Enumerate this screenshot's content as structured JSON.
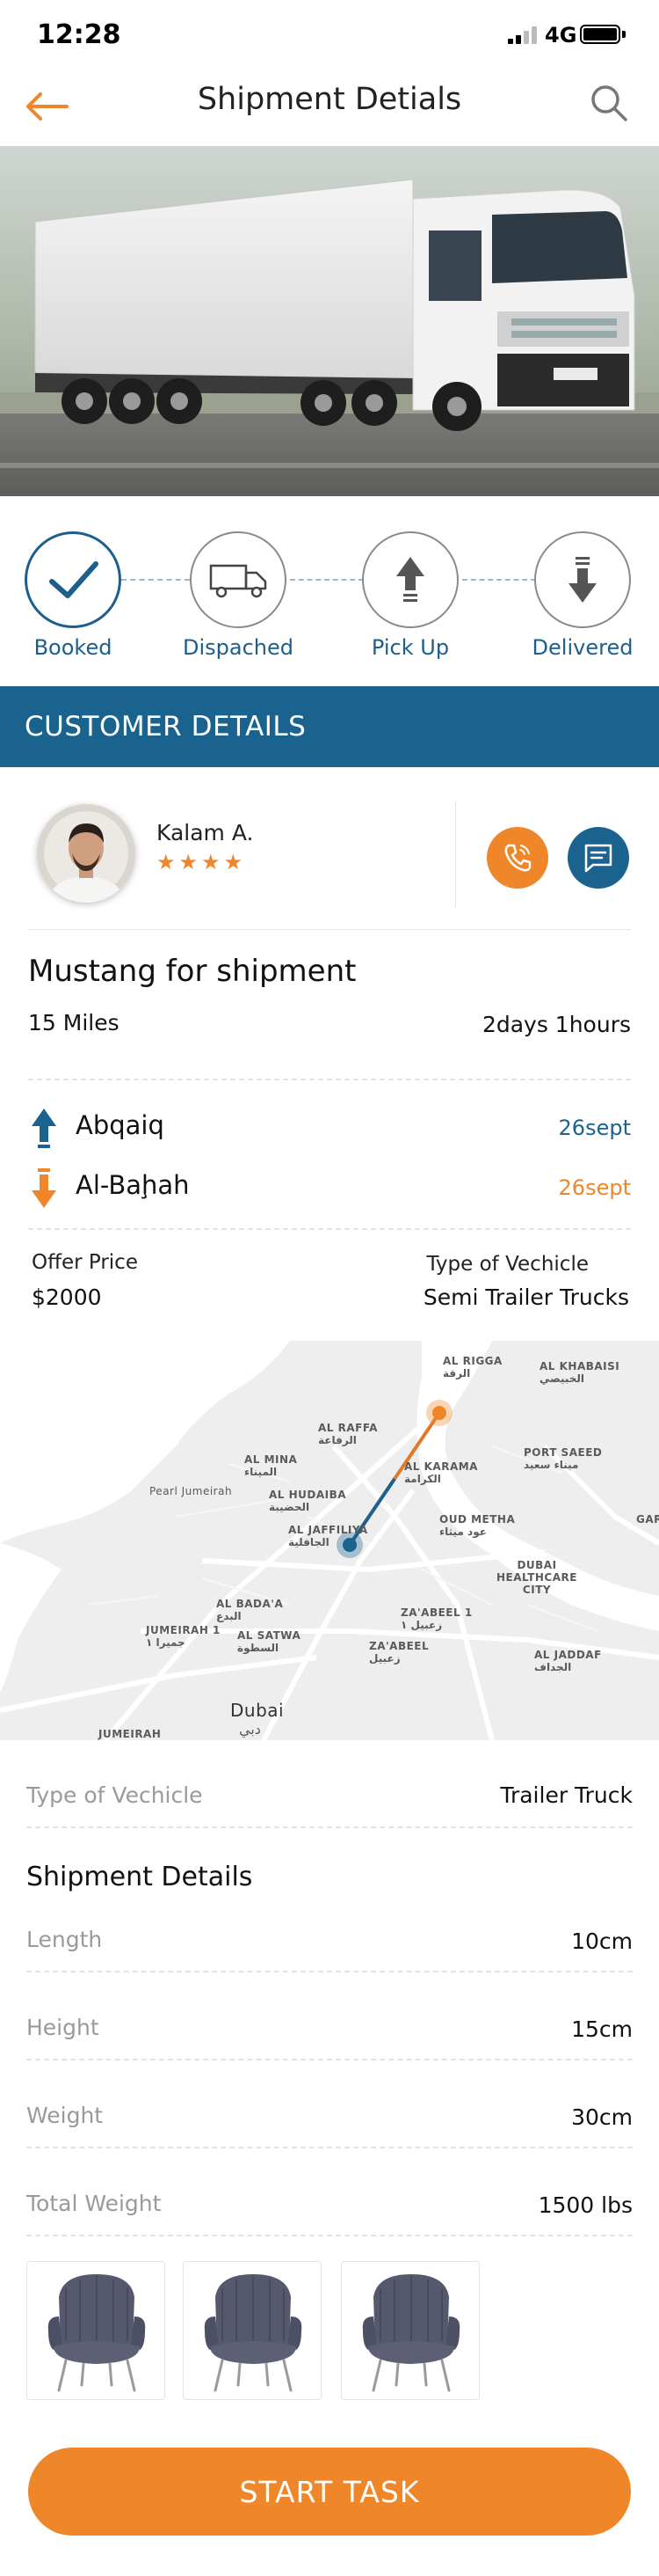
{
  "status_bar": {
    "time": "12:28",
    "network": "4G"
  },
  "header": {
    "title": "Shipment Detials",
    "back_icon": "arrow-left-icon",
    "search_icon": "search-icon"
  },
  "colors": {
    "orange": "#f0862a",
    "blue": "#1a638f"
  },
  "steps": [
    {
      "label": "Booked",
      "icon": "check-icon",
      "active": true
    },
    {
      "label": "Dispached",
      "icon": "truck-icon",
      "active": false
    },
    {
      "label": "Pick Up",
      "icon": "arrow-up-icon",
      "active": false
    },
    {
      "label": "Delivered",
      "icon": "arrow-down-icon",
      "active": false
    }
  ],
  "customer_section": {
    "title": "CUSTOMER DETAILS"
  },
  "customer": {
    "name": "Kalam A.",
    "stars": "★★★★",
    "rating": 4
  },
  "shipment": {
    "title": "Mustang for shipment",
    "distance": "15 Miles",
    "duration": "2days 1hours",
    "origin": {
      "name": "Abqaiq",
      "day": "26",
      "month": "sept"
    },
    "destination": {
      "name": "Al-Baḩah",
      "day": "26",
      "month": "sept"
    },
    "offer_label": "Offer Price",
    "offer_value": "$2000",
    "vehicle_label": "Type of Vechicle",
    "vehicle_value": "Semi Trailer Trucks"
  },
  "map": {
    "labels": {
      "al_rigga": "AL RIGGA",
      "al_rigga_ar": "الرقة",
      "al_khabaisi": "AL KHABAISI",
      "al_khabaisi_ar": "الخبيصي",
      "al_raffa": "AL RAFFA",
      "al_raffa_ar": "الرفاعة",
      "port_saeed": "PORT SAEED",
      "port_saeed_ar": "ميناء سعيد",
      "al_mina": "AL MINA",
      "al_mina_ar": "الميناء",
      "al_karama": "AL KARAMA",
      "al_karama_ar": "الكرامة",
      "pearl_jumeirah": "Pearl Jumeirah",
      "al_hudaiba": "AL HUDAIBA",
      "al_hudaiba_ar": "الحضيبة",
      "oud_metha": "OUD METHA",
      "oud_metha_ar": "عود ميثاء",
      "al_jaffiliya": "AL JAFFILIYA",
      "al_jaffiliya_ar": "الجافلية",
      "dubai_healthcare": "DUBAI HEALTHCARE CITY",
      "al_badaa": "AL BADA'A",
      "al_badaa_ar": "البدع",
      "zaabeel1": "ZA'ABEEL 1",
      "zaabeel1_ar": "زعبيل ١",
      "jumeirah1": "JUMEIRAH 1",
      "jumeirah1_ar": "جميرا ١",
      "al_satwa": "AL SATWA",
      "al_satwa_ar": "السطوة",
      "zaabeel": "ZA'ABEEL",
      "zaabeel_ar": "زعبيل",
      "al_jaddaf": "AL JADDAF",
      "al_jaddaf_ar": "الجداف",
      "dubai": "Dubai",
      "dubai_ar": "دبي",
      "jumeirah": "JUMEIRAH",
      "al_garhoud": "GAR"
    }
  },
  "details": {
    "vehicle_label": "Type of Vechicle",
    "vehicle_value": "Trailer Truck",
    "title": "Shipment Details",
    "rows": [
      {
        "label": "Length",
        "value": "10cm"
      },
      {
        "label": "Height",
        "value": "15cm"
      },
      {
        "label": "Weight",
        "value": "30cm"
      },
      {
        "label": "Total Weight",
        "value": "1500 lbs"
      }
    ]
  },
  "cta": {
    "label": "START TASK"
  }
}
